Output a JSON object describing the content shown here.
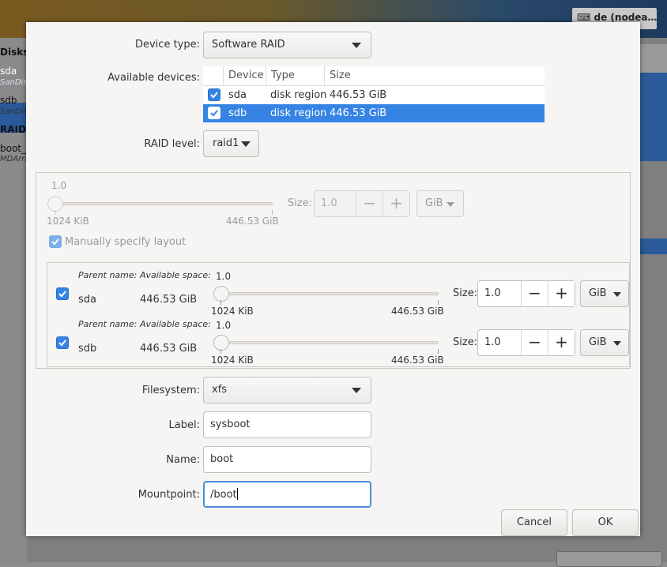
{
  "background": {
    "keyboard_layout": "de (nodea…",
    "left_items": [
      {
        "label": "Disks",
        "sub": ""
      },
      {
        "label": "sda",
        "sub": "SanDisk"
      },
      {
        "label": "sdb",
        "sub": "SanDisk"
      },
      {
        "label": "RAID",
        "sub": ""
      },
      {
        "label": "boot_",
        "sub": "MDArray"
      }
    ]
  },
  "dialog": {
    "device_type": {
      "label": "Device type:",
      "value": "Software RAID"
    },
    "available_devices": {
      "label": "Available devices:",
      "columns": [
        "Device",
        "Type",
        "Size"
      ],
      "rows": [
        {
          "checked": true,
          "device": "sda",
          "type": "disk region",
          "size": "446.53 GiB",
          "selected": false
        },
        {
          "checked": true,
          "device": "sdb",
          "type": "disk region",
          "size": "446.53 GiB",
          "selected": true
        }
      ]
    },
    "raid_level": {
      "label": "RAID level:",
      "value": "raid1"
    },
    "size_section": {
      "slider_value": "1.0",
      "slider_min": "1024 KiB",
      "slider_max": "446.53 GiB",
      "size_label": "Size:",
      "size_value": "1.0",
      "unit": "GiB",
      "manual_layout_label": "Manually specify layout",
      "manual_layout_checked": true
    },
    "layout": {
      "parent_name_header": "Parent name:",
      "available_space_header": "Available space:",
      "rows": [
        {
          "checked": true,
          "parent": "sda",
          "space": "446.53 GiB",
          "slider_value": "1.0",
          "slider_min": "1024 KiB",
          "slider_max": "446.53 GiB",
          "size_label": "Size:",
          "size_value": "1.0",
          "unit": "GiB"
        },
        {
          "checked": true,
          "parent": "sdb",
          "space": "446.53 GiB",
          "slider_value": "1.0",
          "slider_min": "1024 KiB",
          "slider_max": "446.53 GiB",
          "size_label": "Size:",
          "size_value": "1.0",
          "unit": "GiB"
        }
      ]
    },
    "filesystem": {
      "label": "Filesystem:",
      "value": "xfs"
    },
    "fs_label": {
      "label": "Label:",
      "value": "sysboot"
    },
    "name": {
      "label": "Name:",
      "value": "boot"
    },
    "mountpoint": {
      "label": "Mountpoint:",
      "value": "/boot"
    },
    "cancel_label": "Cancel",
    "ok_label": "OK"
  },
  "colors": {
    "accent": "#3584e4",
    "focus": "#4a90d9"
  }
}
